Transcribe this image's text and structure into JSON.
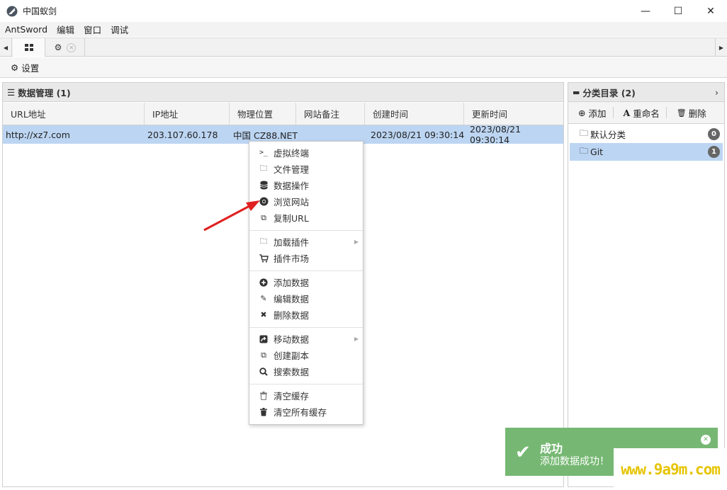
{
  "window": {
    "title": "中国蚁剑",
    "minimize": "—",
    "maximize": "☐",
    "close": "✕"
  },
  "menubar": {
    "items": [
      "AntSword",
      "编辑",
      "窗口",
      "调试"
    ]
  },
  "tabs": {
    "grid_tab_icon": "grid-icon",
    "settings_tab_icon": "gear-icon"
  },
  "toolbar": {
    "settings_label": "设置"
  },
  "data_panel": {
    "title": "数据管理 (1)",
    "columns": [
      "URL地址",
      "IP地址",
      "物理位置",
      "网站备注",
      "创建时间",
      "更新时间"
    ],
    "rows": [
      {
        "url": "http://xz7.com",
        "ip": "203.107.60.178",
        "location": "中国 CZ88.NET",
        "note": "",
        "created": "2023/08/21 09:30:14",
        "updated": "2023/08/21 09:30:14"
      }
    ]
  },
  "category_panel": {
    "title": "分类目录 (2)",
    "add_label": "添加",
    "rename_label": "重命名",
    "delete_label": "删除",
    "items": [
      {
        "name": "默认分类",
        "count": "0"
      },
      {
        "name": "Git",
        "count": "1"
      }
    ]
  },
  "context_menu": {
    "items": [
      {
        "label": "虚拟终端",
        "icon": "terminal-icon"
      },
      {
        "label": "文件管理",
        "icon": "folder-icon"
      },
      {
        "label": "数据操作",
        "icon": "database-icon"
      },
      {
        "label": "浏览网站",
        "icon": "chrome-icon"
      },
      {
        "label": "复制URL",
        "icon": "copy-icon"
      },
      {
        "label": "加载插件",
        "icon": "folder-icon"
      },
      {
        "label": "插件市场",
        "icon": "cart-icon"
      },
      {
        "label": "添加数据",
        "icon": "plus-circle-icon"
      },
      {
        "label": "编辑数据",
        "icon": "edit-icon"
      },
      {
        "label": "删除数据",
        "icon": "close-icon"
      },
      {
        "label": "移动数据",
        "icon": "share-icon"
      },
      {
        "label": "创建副本",
        "icon": "copy-icon"
      },
      {
        "label": "搜索数据",
        "icon": "search-icon"
      },
      {
        "label": "清空缓存",
        "icon": "trash-icon"
      },
      {
        "label": "清空所有缓存",
        "icon": "trash-icon"
      }
    ]
  },
  "toast": {
    "title": "成功",
    "message": "添加数据成功！"
  },
  "watermark": {
    "text": "www.9a9m.com"
  },
  "colors": {
    "selection": "#bcd5f2",
    "toast_bg": "#76b873",
    "arrow": "#e02020",
    "watermark": "#e6c400"
  }
}
